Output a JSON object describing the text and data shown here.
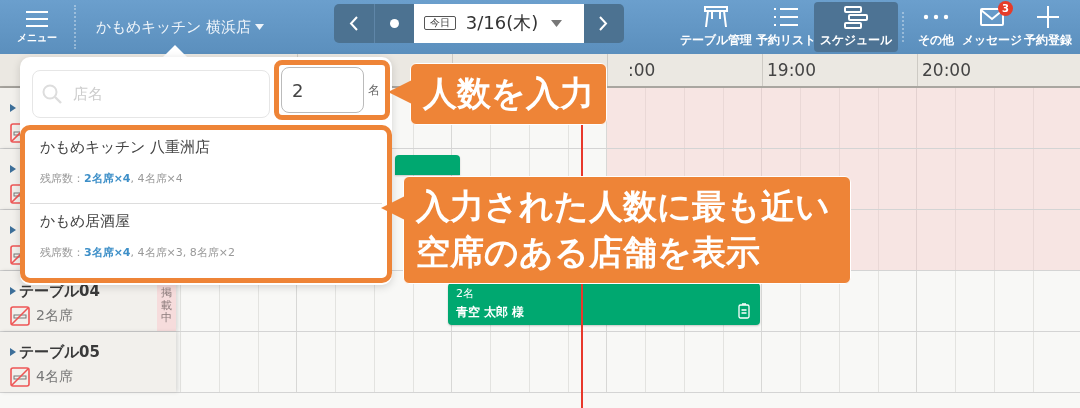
{
  "menu_button": {
    "label": "メニュー"
  },
  "store_selector": {
    "label": "かもめキッチン 横浜店"
  },
  "date_nav": {
    "today_label": "今日",
    "date": "3/16(木)"
  },
  "toolbar": [
    {
      "kind": "table",
      "label": "テーブル管理",
      "selected": false
    },
    {
      "kind": "list",
      "label": "予約リスト",
      "selected": false
    },
    {
      "kind": "schedule",
      "label": "スケジュール",
      "selected": true
    },
    {
      "kind": "more",
      "label": "その他",
      "selected": false
    },
    {
      "kind": "mail",
      "label": "メッセージ",
      "selected": false,
      "badge": "3"
    },
    {
      "kind": "add",
      "label": "予約登録",
      "selected": false
    }
  ],
  "time_labels": [
    ":00",
    "19:00",
    "20:00"
  ],
  "tables": [
    {
      "shaded": true
    },
    {
      "shaded": true,
      "booking": {
        "kind": "covered"
      }
    },
    {
      "shaded": true
    },
    {
      "shaded": false,
      "name": "テーブル04",
      "seats": "2名席",
      "listed": "掲載中",
      "booking": {
        "kind": "full",
        "party": "2名",
        "guest": "青空 太郎 様"
      }
    },
    {
      "shaded": false,
      "name": "テーブル05",
      "seats": "4名席"
    }
  ],
  "store_search": {
    "placeholder": "店名",
    "party_size": "2",
    "party_unit": "名",
    "results": [
      {
        "name": "かもめキッチン 八重洲店",
        "seats": "残席数：**2名席×4**, 4名席×4"
      },
      {
        "name": "かもめ居酒屋",
        "seats": "残席数：**3名席×4**, 4名席×3, 8名席×2"
      }
    ]
  },
  "callouts": [
    {
      "text": "人数を入力"
    },
    {
      "text": "入力された人数に最も近い空席のある店舗を表示"
    }
  ]
}
